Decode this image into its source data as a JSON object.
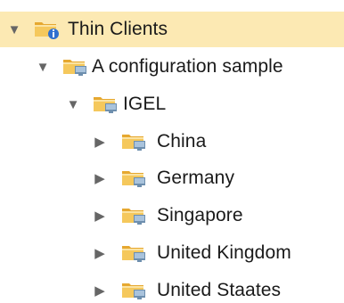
{
  "tree": {
    "root": {
      "label": "Thin Clients",
      "expanded_glyph": "▼",
      "icon": "folder-with-info-badge-icon"
    },
    "group": {
      "label": "A configuration sample",
      "expanded_glyph": "▼",
      "icon": "folder-with-monitor-icon"
    },
    "subgroup": {
      "label": "IGEL",
      "expanded_glyph": "▼",
      "icon": "folder-with-monitor-icon"
    },
    "leaves": [
      {
        "label": "China",
        "collapsed_glyph": "▶",
        "icon": "folder-with-monitor-icon"
      },
      {
        "label": "Germany",
        "collapsed_glyph": "▶",
        "icon": "folder-with-monitor-icon"
      },
      {
        "label": "Singapore",
        "collapsed_glyph": "▶",
        "icon": "folder-with-monitor-icon"
      },
      {
        "label": "United Kingdom",
        "collapsed_glyph": "▶",
        "icon": "folder-with-monitor-icon"
      },
      {
        "label": "United Staates",
        "collapsed_glyph": "▶",
        "icon": "folder-with-monitor-icon"
      }
    ]
  },
  "colors": {
    "selected_row_bg": "#fce9b3",
    "folder_body": "#f5c85c",
    "folder_tab": "#e6a830",
    "monitor": "#6e8fae",
    "info_badge": "#2f6fcf",
    "text": "#1a1a1a",
    "arrow": "#666666"
  }
}
